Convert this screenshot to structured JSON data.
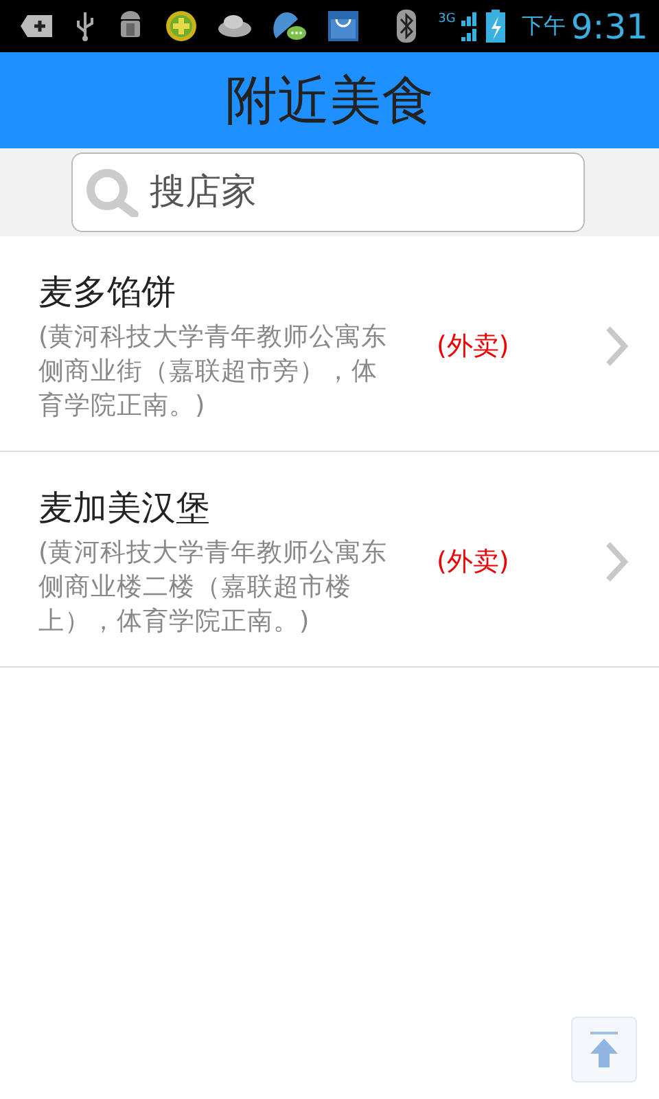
{
  "status_bar": {
    "network": "3G",
    "period": "下午",
    "time": "9:31"
  },
  "header": {
    "title": "附近美食"
  },
  "search": {
    "placeholder": "搜店家"
  },
  "restaurants": [
    {
      "name": "麦多馅饼",
      "address": "(黄河科技大学青年教师公寓东侧商业街（嘉联超市旁），体育学院正南。)",
      "tag": "(外卖)"
    },
    {
      "name": "麦加美汉堡",
      "address": "(黄河科技大学青年教师公寓东侧商业楼二楼（嘉联超市楼上），体育学院正南。)",
      "tag": "(外卖)"
    }
  ]
}
